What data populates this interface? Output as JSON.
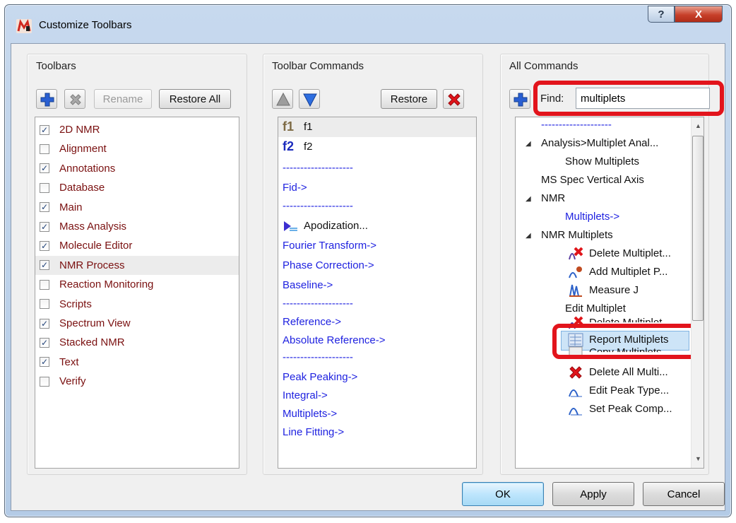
{
  "window": {
    "title": "Customize Toolbars",
    "help_label": "?",
    "close_label": "X"
  },
  "toolbars": {
    "group_title": "Toolbars",
    "rename_label": "Rename",
    "restore_all_label": "Restore All",
    "items": [
      {
        "label": "2D NMR",
        "checked": true
      },
      {
        "label": "Alignment",
        "checked": false
      },
      {
        "label": "Annotations",
        "checked": true
      },
      {
        "label": "Database",
        "checked": false
      },
      {
        "label": "Main",
        "checked": true
      },
      {
        "label": "Mass Analysis",
        "checked": true
      },
      {
        "label": "Molecule Editor",
        "checked": true
      },
      {
        "label": "NMR Process",
        "checked": true
      },
      {
        "label": "Reaction Monitoring",
        "checked": false
      },
      {
        "label": "Scripts",
        "checked": false
      },
      {
        "label": "Spectrum View",
        "checked": true
      },
      {
        "label": "Stacked NMR",
        "checked": true
      },
      {
        "label": "Text",
        "checked": true
      },
      {
        "label": "Verify",
        "checked": false
      }
    ]
  },
  "toolbar_commands": {
    "group_title": "Toolbar Commands",
    "restore_label": "Restore",
    "items": [
      {
        "label": "f1",
        "icon": "f1"
      },
      {
        "label": "f2",
        "icon": "f2"
      },
      {
        "label": "--------------------"
      },
      {
        "label": "Fid->"
      },
      {
        "label": "--------------------"
      },
      {
        "label": "Apodization...",
        "icon": "apodization"
      },
      {
        "label": "Fourier Transform->"
      },
      {
        "label": "Phase Correction->"
      },
      {
        "label": "Baseline->"
      },
      {
        "label": "--------------------"
      },
      {
        "label": "Reference->"
      },
      {
        "label": "Absolute Reference->"
      },
      {
        "label": "--------------------"
      },
      {
        "label": "Peak Peaking->"
      },
      {
        "label": "Integral->"
      },
      {
        "label": "Multiplets->"
      },
      {
        "label": "Line Fitting->"
      }
    ]
  },
  "all_commands": {
    "group_title": "All Commands",
    "find_label": "Find:",
    "find_value": "multiplets",
    "items": [
      {
        "label": "--------------------"
      },
      {
        "label": "Analysis>Multiplet Anal..."
      },
      {
        "label": "Show Multiplets"
      },
      {
        "label": "MS Spec Vertical Axis"
      },
      {
        "label": "NMR"
      },
      {
        "label": "Multiplets->"
      },
      {
        "label": "NMR Multiplets"
      },
      {
        "label": "Delete Multiplet..."
      },
      {
        "label": "Add Multiplet P..."
      },
      {
        "label": "Measure J"
      },
      {
        "label": "Edit Multiplet"
      },
      {
        "label": "Delete Multiplet..."
      },
      {
        "label": "Report Multiplets"
      },
      {
        "label": "Copy Multiplets"
      },
      {
        "label": "Delete All Multi..."
      },
      {
        "label": "Edit Peak Type..."
      },
      {
        "label": "Set Peak Comp..."
      }
    ]
  },
  "buttons": {
    "ok": "OK",
    "apply": "Apply",
    "cancel": "Cancel"
  },
  "colors": {
    "highlight": "#e2141c",
    "link": "#1f22e0",
    "toolbar_label": "#7a1010"
  }
}
